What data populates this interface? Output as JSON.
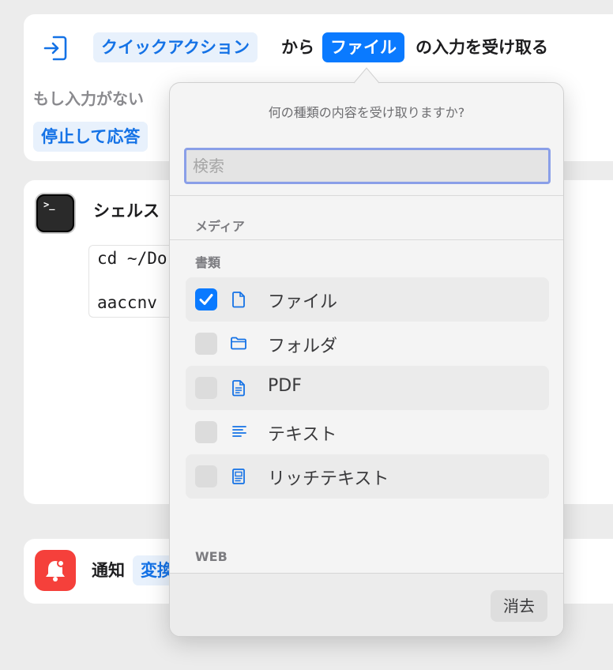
{
  "receive_action": {
    "token_quick_action": "クイックアクション",
    "text_from": "から",
    "token_file": "ファイル",
    "text_receive": "の入力を受け取る",
    "no_input_label": "もし入力がない",
    "token_stop": "停止して応答"
  },
  "shell_action": {
    "title": "シェルス",
    "terminal_glyph": ">_",
    "code_line_1": "cd ~/Do",
    "code_line_2": "aaccnv"
  },
  "notify_action": {
    "title": "通知",
    "token_variable": "変換"
  },
  "popover": {
    "title": "何の種類の内容を受け取りますか?",
    "search_placeholder": "検索",
    "section_media": "メディア",
    "section_documents": "書類",
    "section_web": "WEB",
    "items": [
      {
        "label": "ファイル",
        "checked": true,
        "icon": "document-icon"
      },
      {
        "label": "フォルダ",
        "checked": false,
        "icon": "folder-icon"
      },
      {
        "label": "PDF",
        "checked": false,
        "icon": "pdf-icon"
      },
      {
        "label": "テキスト",
        "checked": false,
        "icon": "text-lines-icon"
      },
      {
        "label": "リッチテキスト",
        "checked": false,
        "icon": "rich-text-icon"
      }
    ],
    "clear_label": "消去"
  },
  "colors": {
    "accent": "#0a7aff",
    "token_bg": "#e8f1fc",
    "token_text": "#1472e6",
    "notify_red": "#f5403b"
  }
}
